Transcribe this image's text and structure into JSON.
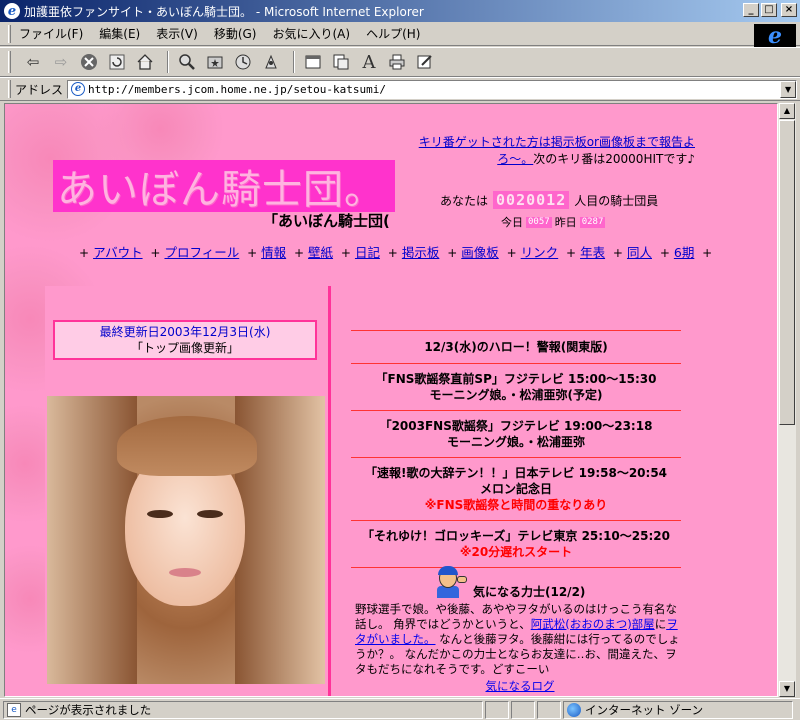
{
  "window": {
    "title": "加護亜依ファンサイト・あいぼん騎士団。 - Microsoft Internet Explorer",
    "minimize": "_",
    "maximize": "□",
    "close": "×"
  },
  "menu": [
    "ファイル(F)",
    "編集(E)",
    "表示(V)",
    "移動(G)",
    "お気に入り(A)",
    "ヘルプ(H)"
  ],
  "address": {
    "label": "アドレス",
    "url": "http://members.jcom.home.ne.jp/setou-katsumi/"
  },
  "toolbar_icons": [
    "back-icon",
    "forward-icon",
    "stop-icon",
    "refresh-icon",
    "home-icon",
    "search-icon",
    "favorites-icon",
    "history-icon",
    "channels-icon",
    "fullscreen-icon",
    "mail-icon",
    "font-icon",
    "print-icon",
    "edit-icon"
  ],
  "site": {
    "logo": "あいぼん騎士団。",
    "subtitle": "「あいぼん騎士団(",
    "notice_link": "キリ番ゲットされた方は掲示板or画像板まで報告よろ～。",
    "notice_rest": "次のキリ番は20000HITです♪",
    "visitor_prefix": "あなたは",
    "visitor_count": "0020012",
    "visitor_suffix": "人目の騎士団員",
    "today_label": "今日",
    "today_count": "0057",
    "yesterday_label": "昨日",
    "yesterday_count": "0287"
  },
  "nav": [
    "アバウト",
    "プロフィール",
    "情報",
    "壁紙",
    "日記",
    "掲示板",
    "画像板",
    "リンク",
    "年表",
    "同人",
    "6期"
  ],
  "update": {
    "date": "最終更新日2003年12月3日(水)",
    "note": "「トップ画像更新」"
  },
  "news": {
    "header": "12/3(水)のハロー！警報(関東版)",
    "items": [
      {
        "line1": "「FNS歌謡祭直前SP」フジテレビ 15:00～15:30",
        "line2": "モーニング娘。・松浦亜弥(予定)",
        "warn": ""
      },
      {
        "line1": "「2003FNS歌謡祭」フジテレビ 19:00～23:18",
        "line2": "モーニング娘。・松浦亜弥",
        "warn": ""
      },
      {
        "line1": "「速報!歌の大辞テン！！」日本テレビ 19:58～20:54",
        "line2": "メロン記念日",
        "warn": "※FNS歌謡祭と時間の重なりあり"
      },
      {
        "line1": "「それゆけ！ゴロッキーズ」テレビ東京 25:10～25:20",
        "line2": "",
        "warn": "※20分遅れスタート"
      }
    ]
  },
  "column": {
    "title": "気になる力士(12/2)",
    "text1": "野球選手で娘。や後藤、あややヲタがいるのはけっこう有名な話し。 角界ではどうかというと、",
    "link1": "阿武松(おおのまつ)部屋",
    "text2": "に",
    "link2": "ヲタがいました。",
    "text3": " なんと後藤ヲタ。後藤紺には行ってるのでしょうか？。 なんだかこの力士とならお友達に‥お、間違えた、ヲタもだちになれそうです。どすこーい",
    "more": "気になるログ"
  },
  "status": {
    "text": "ページが表示されました",
    "zone": "インターネット ゾーン"
  },
  "colors": {
    "page_bg": "#ff99cc",
    "logo_bg": "#ff33cc",
    "divider": "#ff3399",
    "rule": "#ff3333",
    "warn": "#ff0000",
    "link": "#0000cc"
  }
}
